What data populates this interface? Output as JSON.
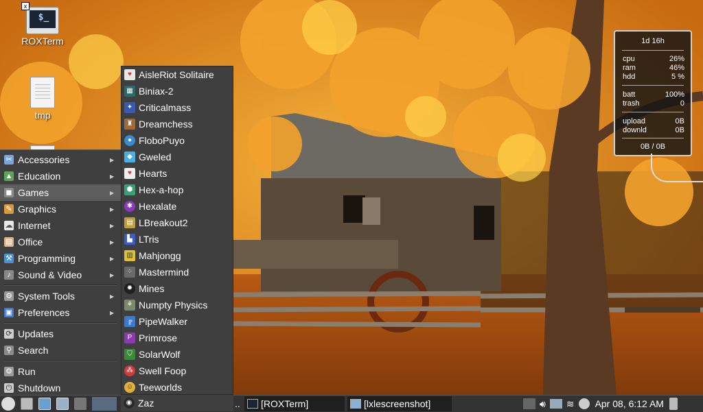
{
  "desktop": {
    "icons": [
      {
        "label": "ROXTerm",
        "icon": "terminal-icon"
      },
      {
        "label": "tmp",
        "icon": "text-file-icon"
      }
    ]
  },
  "menu": {
    "items": [
      {
        "label": "Accessories",
        "icon": "accessories-icon",
        "color": "#7aa7d9"
      },
      {
        "label": "Education",
        "icon": "education-icon",
        "color": "#5fa35f"
      },
      {
        "label": "Games",
        "icon": "games-icon",
        "color": "#8a8a8a"
      },
      {
        "label": "Graphics",
        "icon": "graphics-icon",
        "color": "#d99a3a"
      },
      {
        "label": "Internet",
        "icon": "internet-icon",
        "color": "#e8e8e8"
      },
      {
        "label": "Office",
        "icon": "office-icon",
        "color": "#d9b48a"
      },
      {
        "label": "Programming",
        "icon": "programming-icon",
        "color": "#4a90d9"
      },
      {
        "label": "Sound & Video",
        "icon": "sound-video-icon",
        "color": "#888888"
      },
      {
        "label": "System Tools",
        "icon": "system-tools-icon",
        "color": "#9a9a9a"
      },
      {
        "label": "Preferences",
        "icon": "preferences-icon",
        "color": "#3a7ad0"
      },
      {
        "label": "Updates",
        "icon": "updates-icon",
        "color": "#cfcfcf"
      },
      {
        "label": "Search",
        "icon": "search-icon",
        "color": "#8a8a8a"
      },
      {
        "label": "Run",
        "icon": "run-icon",
        "color": "#9a9a9a"
      },
      {
        "label": "Shutdown",
        "icon": "shutdown-icon",
        "color": "#cccccc"
      }
    ],
    "active": "Games"
  },
  "games": {
    "items": [
      {
        "label": "AisleRiot Solitaire",
        "icon": "card-icon",
        "color": "#e8e8e8"
      },
      {
        "label": "Biniax-2",
        "icon": "biniax-icon",
        "color": "#2a6a6a"
      },
      {
        "label": "Criticalmass",
        "icon": "criticalmass-icon",
        "color": "#3a5ab0"
      },
      {
        "label": "Dreamchess",
        "icon": "chess-icon",
        "color": "#a06a3a"
      },
      {
        "label": "FloboPuyo",
        "icon": "flobopuyo-icon",
        "color": "#3a8ad0"
      },
      {
        "label": "Gweled",
        "icon": "gem-icon",
        "color": "#4ab0e0"
      },
      {
        "label": "Hearts",
        "icon": "hearts-icon",
        "color": "#d03a3a"
      },
      {
        "label": "Hex-a-hop",
        "icon": "hexahop-icon",
        "color": "#3aa07a"
      },
      {
        "label": "Hexalate",
        "icon": "hexalate-icon",
        "color": "#8a3ac0"
      },
      {
        "label": "LBreakout2",
        "icon": "breakout-icon",
        "color": "#c0a03a"
      },
      {
        "label": "LTris",
        "icon": "tetris-icon",
        "color": "#3a5ad0"
      },
      {
        "label": "Mahjongg",
        "icon": "mahjongg-icon",
        "color": "#e0c03a"
      },
      {
        "label": "Mastermind",
        "icon": "mastermind-icon",
        "color": "#6a6a6a"
      },
      {
        "label": "Mines",
        "icon": "mine-icon",
        "color": "#202020"
      },
      {
        "label": "Numpty Physics",
        "icon": "physics-icon",
        "color": "#7a8a6a"
      },
      {
        "label": "PipeWalker",
        "icon": "pipe-icon",
        "color": "#3a7ad0"
      },
      {
        "label": "Primrose",
        "icon": "primrose-icon",
        "color": "#8a3ab0"
      },
      {
        "label": "SolarWolf",
        "icon": "solarwolf-icon",
        "color": "#3a8a3a"
      },
      {
        "label": "Swell Foop",
        "icon": "swellfoop-icon",
        "color": "#d03a3a"
      },
      {
        "label": "Teeworlds",
        "icon": "teeworlds-icon",
        "color": "#e0b03a"
      },
      {
        "label": "Zaz",
        "icon": "zaz-icon",
        "color": "#2a2a2a"
      }
    ]
  },
  "conky": {
    "uptime": "1d 16h",
    "cpu": {
      "label": "cpu",
      "value": "26%"
    },
    "ram": {
      "label": "ram",
      "value": "46%"
    },
    "hdd": {
      "label": "hdd",
      "value": "5 %"
    },
    "batt": {
      "label": "batt",
      "value": "100%"
    },
    "trash": {
      "label": "trash",
      "value": "0"
    },
    "upload": {
      "label": "upload",
      "value": "0B"
    },
    "downld": {
      "label": "downld",
      "value": "0B"
    },
    "total_down": "0B",
    "total_sep": "/ 0B"
  },
  "taskbar": {
    "ellipsis": "..",
    "tasks": [
      {
        "label": "[ROXTerm]",
        "icon": "terminal-icon"
      },
      {
        "label": "[lxlescreenshot]",
        "icon": "folder-icon"
      }
    ],
    "clock": "Apr 08,  6:12 AM"
  }
}
